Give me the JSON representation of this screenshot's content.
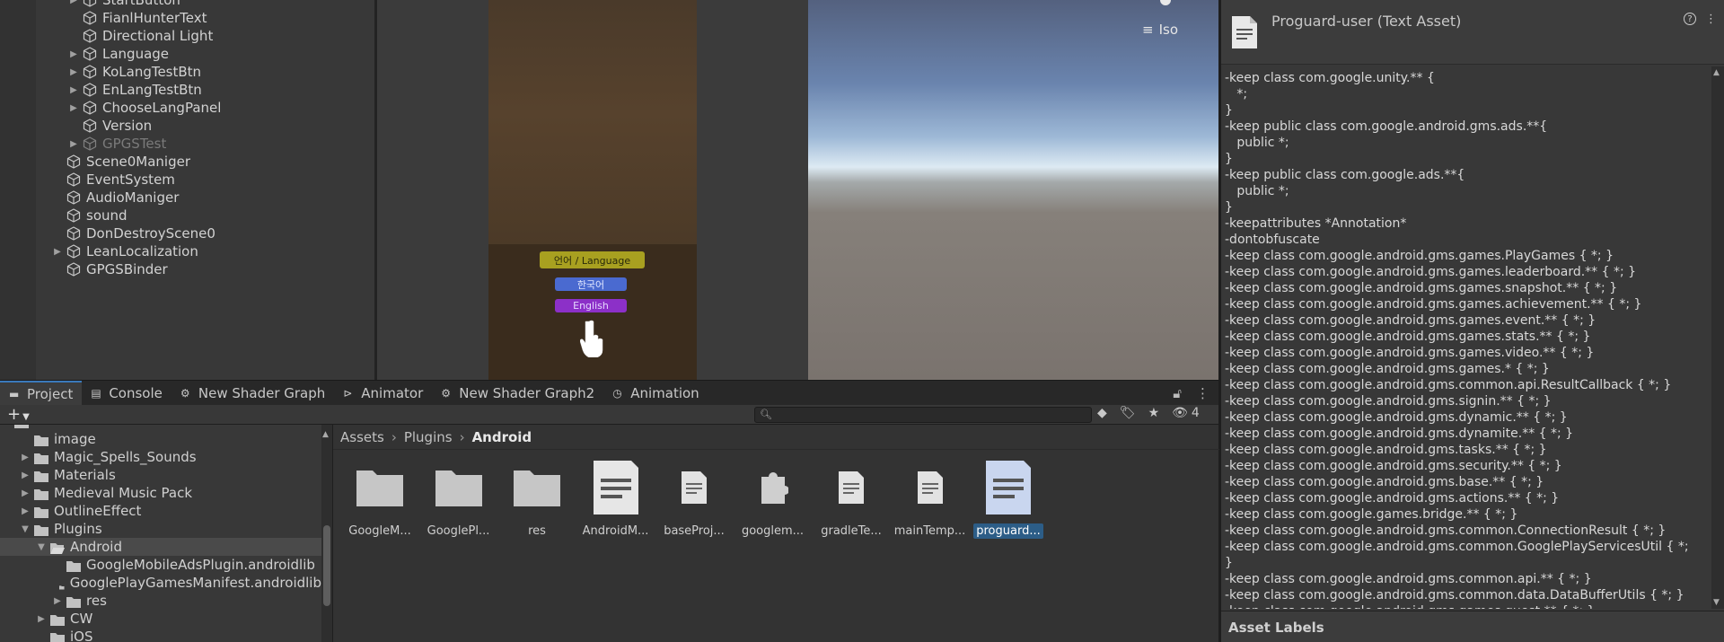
{
  "hierarchy": {
    "items": [
      {
        "label": "StartButton",
        "arrow": "▶",
        "indent": 1,
        "disabled": false,
        "partial": true
      },
      {
        "label": "FianlHunterText",
        "arrow": "",
        "indent": 1,
        "disabled": false
      },
      {
        "label": "Directional Light",
        "arrow": "",
        "indent": 1,
        "disabled": false
      },
      {
        "label": "Language",
        "arrow": "▶",
        "indent": 1,
        "disabled": false
      },
      {
        "label": "KoLangTestBtn",
        "arrow": "▶",
        "indent": 1,
        "disabled": false
      },
      {
        "label": "EnLangTestBtn",
        "arrow": "▶",
        "indent": 1,
        "disabled": false
      },
      {
        "label": "ChooseLangPanel",
        "arrow": "▶",
        "indent": 1,
        "disabled": false
      },
      {
        "label": "Version",
        "arrow": "",
        "indent": 1,
        "disabled": false
      },
      {
        "label": "GPGSTest",
        "arrow": "▶",
        "indent": 1,
        "disabled": true
      },
      {
        "label": "Scene0Maniger",
        "arrow": "",
        "indent": 0,
        "disabled": false
      },
      {
        "label": "EventSystem",
        "arrow": "",
        "indent": 0,
        "disabled": false
      },
      {
        "label": "AudioManiger",
        "arrow": "",
        "indent": 0,
        "disabled": false
      },
      {
        "label": "sound",
        "arrow": "",
        "indent": 0,
        "disabled": false
      },
      {
        "label": "DonDestroyScene0",
        "arrow": "",
        "indent": 0,
        "disabled": false
      },
      {
        "label": "LeanLocalization",
        "arrow": "▶",
        "indent": 0,
        "disabled": false
      },
      {
        "label": "GPGSBinder",
        "arrow": "",
        "indent": 0,
        "disabled": false
      }
    ]
  },
  "game": {
    "lang_button": "언어 / Language",
    "ko_button": "한국어",
    "en_button": "English"
  },
  "scene": {
    "iso_label": "Iso"
  },
  "tabs": [
    {
      "label": "Project",
      "icon": "folder-icon",
      "active": true
    },
    {
      "label": "Console",
      "icon": "console-icon",
      "active": false
    },
    {
      "label": "New Shader Graph",
      "icon": "shader-graph-icon",
      "active": false
    },
    {
      "label": "Animator",
      "icon": "animator-icon",
      "active": false
    },
    {
      "label": "New Shader Graph2",
      "icon": "shader-graph-icon",
      "active": false
    },
    {
      "label": "Animation",
      "icon": "animation-icon",
      "active": false
    }
  ],
  "toolbar": {
    "add_label": "+",
    "hidden_count": "4",
    "search_value": ""
  },
  "project_tree": [
    {
      "label": "image",
      "arrow": "",
      "indent": 0,
      "selected": false,
      "type": "folder"
    },
    {
      "label": "Magic_Spells_Sounds",
      "arrow": "▶",
      "indent": 0,
      "selected": false,
      "type": "folder"
    },
    {
      "label": "Materials",
      "arrow": "▶",
      "indent": 0,
      "selected": false,
      "type": "folder"
    },
    {
      "label": "Medieval Music Pack",
      "arrow": "▶",
      "indent": 0,
      "selected": false,
      "type": "folder"
    },
    {
      "label": "OutlineEffect",
      "arrow": "▶",
      "indent": 0,
      "selected": false,
      "type": "folder"
    },
    {
      "label": "Plugins",
      "arrow": "▼",
      "indent": 0,
      "selected": false,
      "type": "folder"
    },
    {
      "label": "Android",
      "arrow": "▼",
      "indent": 1,
      "selected": true,
      "type": "folder-open"
    },
    {
      "label": "GoogleMobileAdsPlugin.androidlib",
      "arrow": "",
      "indent": 2,
      "selected": false,
      "type": "folder"
    },
    {
      "label": "GooglePlayGamesManifest.androidlib",
      "arrow": "",
      "indent": 2,
      "selected": false,
      "type": "folder"
    },
    {
      "label": "res",
      "arrow": "▶",
      "indent": 2,
      "selected": false,
      "type": "folder"
    },
    {
      "label": "CW",
      "arrow": "▶",
      "indent": 1,
      "selected": false,
      "type": "folder"
    },
    {
      "label": "iOS",
      "arrow": "",
      "indent": 1,
      "selected": false,
      "type": "folder"
    }
  ],
  "breadcrumb": [
    "Assets",
    "Plugins",
    "Android"
  ],
  "assets": [
    {
      "name": "GoogleM...",
      "kind": "folder"
    },
    {
      "name": "GooglePl...",
      "kind": "folder"
    },
    {
      "name": "res",
      "kind": "folder"
    },
    {
      "name": "AndroidM...",
      "kind": "doc-large"
    },
    {
      "name": "baseProj...",
      "kind": "doc-small"
    },
    {
      "name": "googlem...",
      "kind": "plugin"
    },
    {
      "name": "gradleTe...",
      "kind": "doc-small"
    },
    {
      "name": "mainTemp...",
      "kind": "doc-small"
    },
    {
      "name": "proguard...",
      "kind": "doc-large-selected",
      "selected": true
    }
  ],
  "inspector": {
    "title": "Proguard-user (Text Asset)",
    "help": "?",
    "menu": "⋮",
    "lines": [
      "-keep class com.google.unity.** {",
      "   *;",
      "}",
      "-keep public class com.google.android.gms.ads.**{",
      "   public *;",
      "}",
      "-keep public class com.google.ads.**{",
      "   public *;",
      "}",
      "-keepattributes *Annotation*",
      "-dontobfuscate",
      "-keep class com.google.android.gms.games.PlayGames { *; }",
      "-keep class com.google.android.gms.games.leaderboard.** { *; }",
      "-keep class com.google.android.gms.games.snapshot.** { *; }",
      "-keep class com.google.android.gms.games.achievement.** { *; }",
      "-keep class com.google.android.gms.games.event.** { *; }",
      "-keep class com.google.android.gms.games.stats.** { *; }",
      "-keep class com.google.android.gms.games.video.** { *; }",
      "-keep class com.google.android.gms.games.* { *; }",
      "-keep class com.google.android.gms.common.api.ResultCallback { *; }",
      "-keep class com.google.android.gms.signin.** { *; }",
      "-keep class com.google.android.gms.dynamic.** { *; }",
      "-keep class com.google.android.gms.dynamite.** { *; }",
      "-keep class com.google.android.gms.tasks.** { *; }",
      "-keep class com.google.android.gms.security.** { *; }",
      "-keep class com.google.android.gms.base.** { *; }",
      "-keep class com.google.android.gms.actions.** { *; }",
      "-keep class com.google.games.bridge.** { *; }",
      "-keep class com.google.android.gms.common.ConnectionResult { *; }",
      "-keep class com.google.android.gms.common.GooglePlayServicesUtil { *;",
      "}",
      "-keep class com.google.android.gms.common.api.** { *; }",
      "-keep class com.google.android.gms.common.data.DataBufferUtils { *; }",
      "-keep class com.google.android.gms.games.quest.** { *; }"
    ],
    "asset_labels": "Asset Labels"
  },
  "colors": {
    "accent": "#3a79bb",
    "selection": "#2c5d87",
    "panel": "#383838"
  }
}
